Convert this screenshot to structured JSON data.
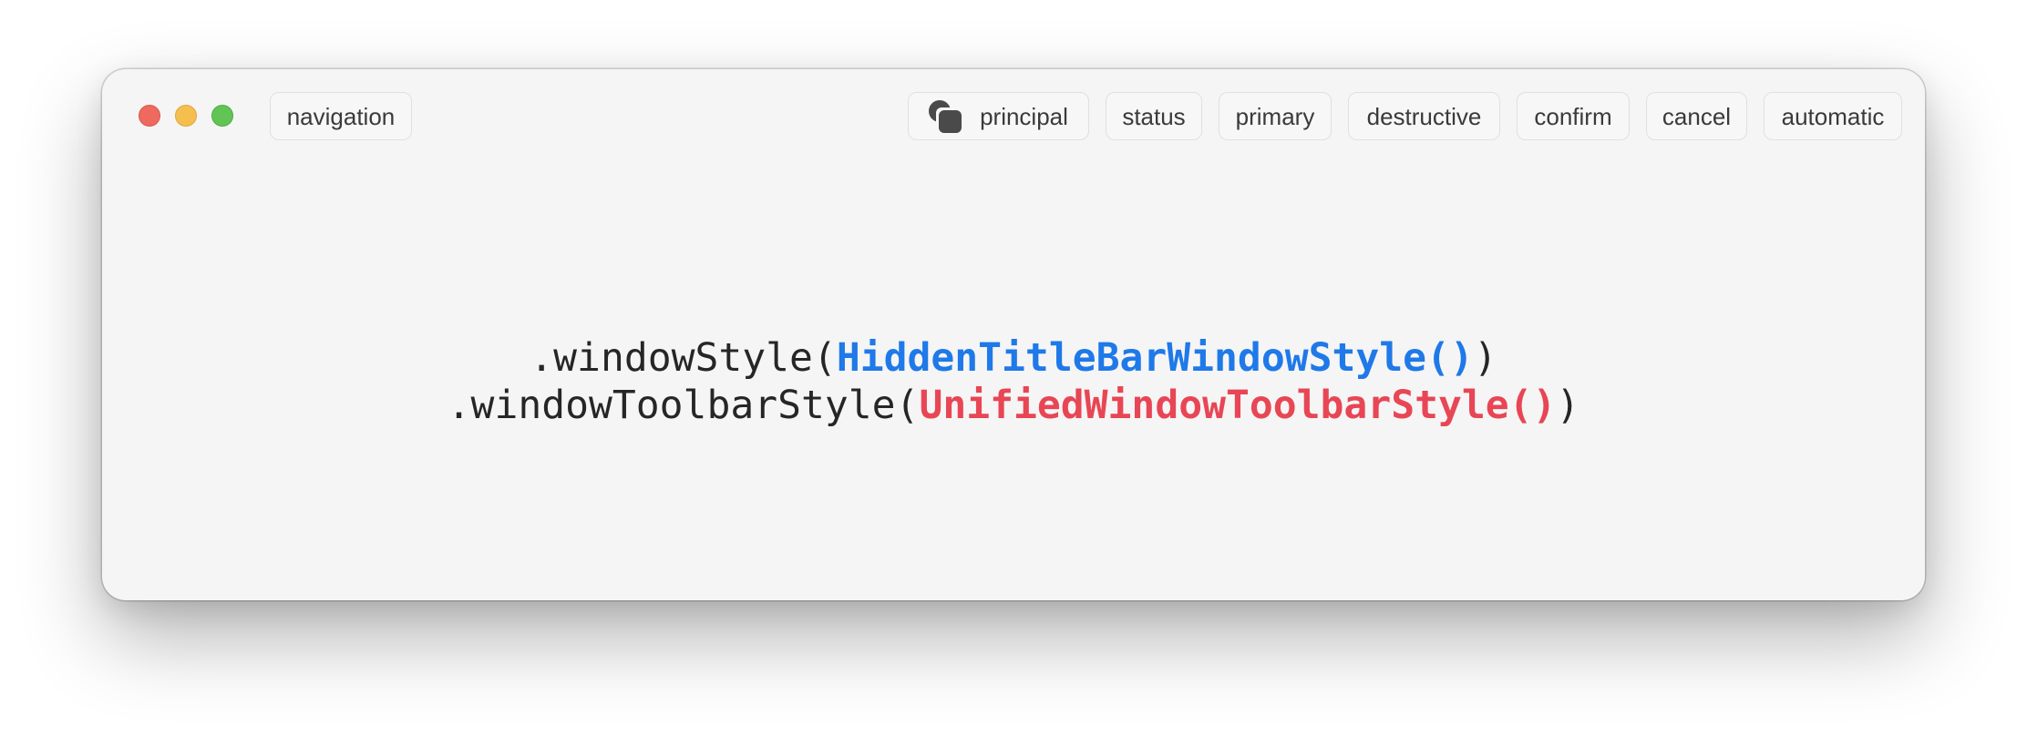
{
  "window": {
    "controls": {
      "close": "close-button",
      "minimize": "minimize-button",
      "zoom": "zoom-button"
    }
  },
  "toolbar": {
    "navigation": "navigation",
    "principal": "principal",
    "principal_icon": "windows-stack-icon",
    "status": "status",
    "primary": "primary",
    "destructive": "destructive",
    "confirm": "confirm",
    "cancel": "cancel",
    "automatic": "automatic"
  },
  "code": {
    "line1_prefix": ".windowStyle(",
    "line1_value": "HiddenTitleBarWindowStyle()",
    "line1_suffix": ")",
    "line2_prefix": ".windowToolbarStyle(",
    "line2_value": "UnifiedWindowToolbarStyle()",
    "line2_suffix": ")"
  },
  "colors": {
    "line1_value": "#1f79e8",
    "line2_value": "#e84655",
    "close": "#ee6a5e",
    "minimize": "#f5bf4f",
    "zoom": "#61c454"
  }
}
